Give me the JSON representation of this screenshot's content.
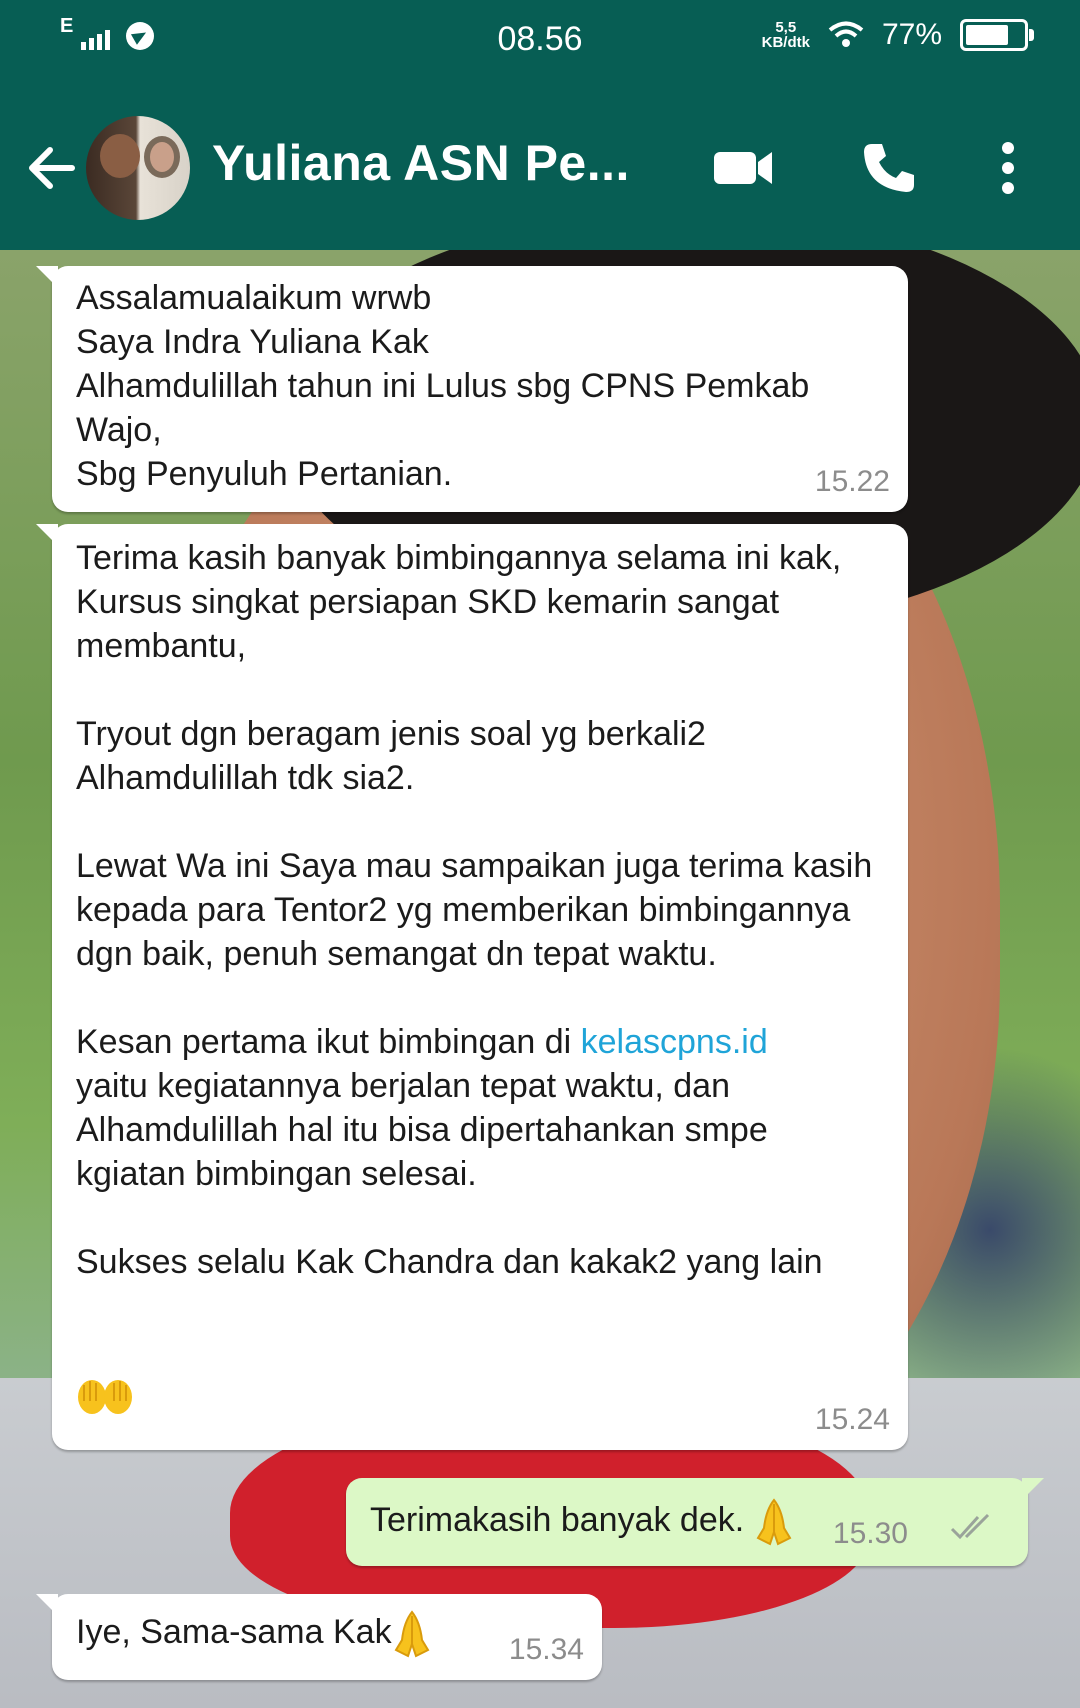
{
  "status_bar": {
    "network": "E",
    "time": "08.56",
    "speed_value": "5,5",
    "speed_unit": "KB/dtk",
    "battery_percent": "77%",
    "battery_level": 0.77
  },
  "header": {
    "contact_name": "Yuliana ASN Pe...",
    "icons": [
      "back-arrow-icon",
      "video-call-icon",
      "phone-icon",
      "more-vert-icon"
    ]
  },
  "messages": [
    {
      "direction": "incoming",
      "text": "Assalamualaikum wrwb\nSaya Indra Yuliana Kak\nAlhamdulillah tahun ini Lulus sbg CPNS Pemkab Wajo,\nSbg Penyuluh Pertanian.",
      "time": "15.22"
    },
    {
      "direction": "incoming",
      "text_part1": "Terima kasih banyak bimbingannya selama ini kak,\nKursus singkat persiapan SKD kemarin sangat membantu,\n\nTryout dgn beragam jenis soal yg berkali2 Alhamdulillah tdk sia2.\n\nLewat Wa ini Saya mau sampaikan juga terima kasih kepada para Tentor2 yg memberikan bimbingannya dgn baik, penuh semangat dn tepat waktu.\n\nKesan pertama ikut bimbingan di ",
      "link": "kelascpns.id",
      "text_part2": "\nyaitu kegiatannya berjalan tepat waktu, dan Alhamdulillah hal itu bisa dipertahankan smpe kgiatan bimbingan selesai.\n\nSukses selalu Kak Chandra dan kakak2 yang lain",
      "emoji": "raising-hands-emoji",
      "time": "15.24"
    },
    {
      "direction": "outgoing",
      "text": "Terimakasih banyak dek. ",
      "emoji": "folded-hands-emoji",
      "time": "15.30",
      "status_icon": "double-check-icon"
    },
    {
      "direction": "incoming",
      "text": "Iye, Sama-sama Kak",
      "emoji": "folded-hands-emoji",
      "time": "15.34"
    }
  ],
  "colors": {
    "header": "#075e54",
    "incoming_bubble": "#ffffff",
    "outgoing_bubble": "#dcf8c6",
    "link": "#1fa4d8",
    "timestamp": "#8c8c8c"
  }
}
